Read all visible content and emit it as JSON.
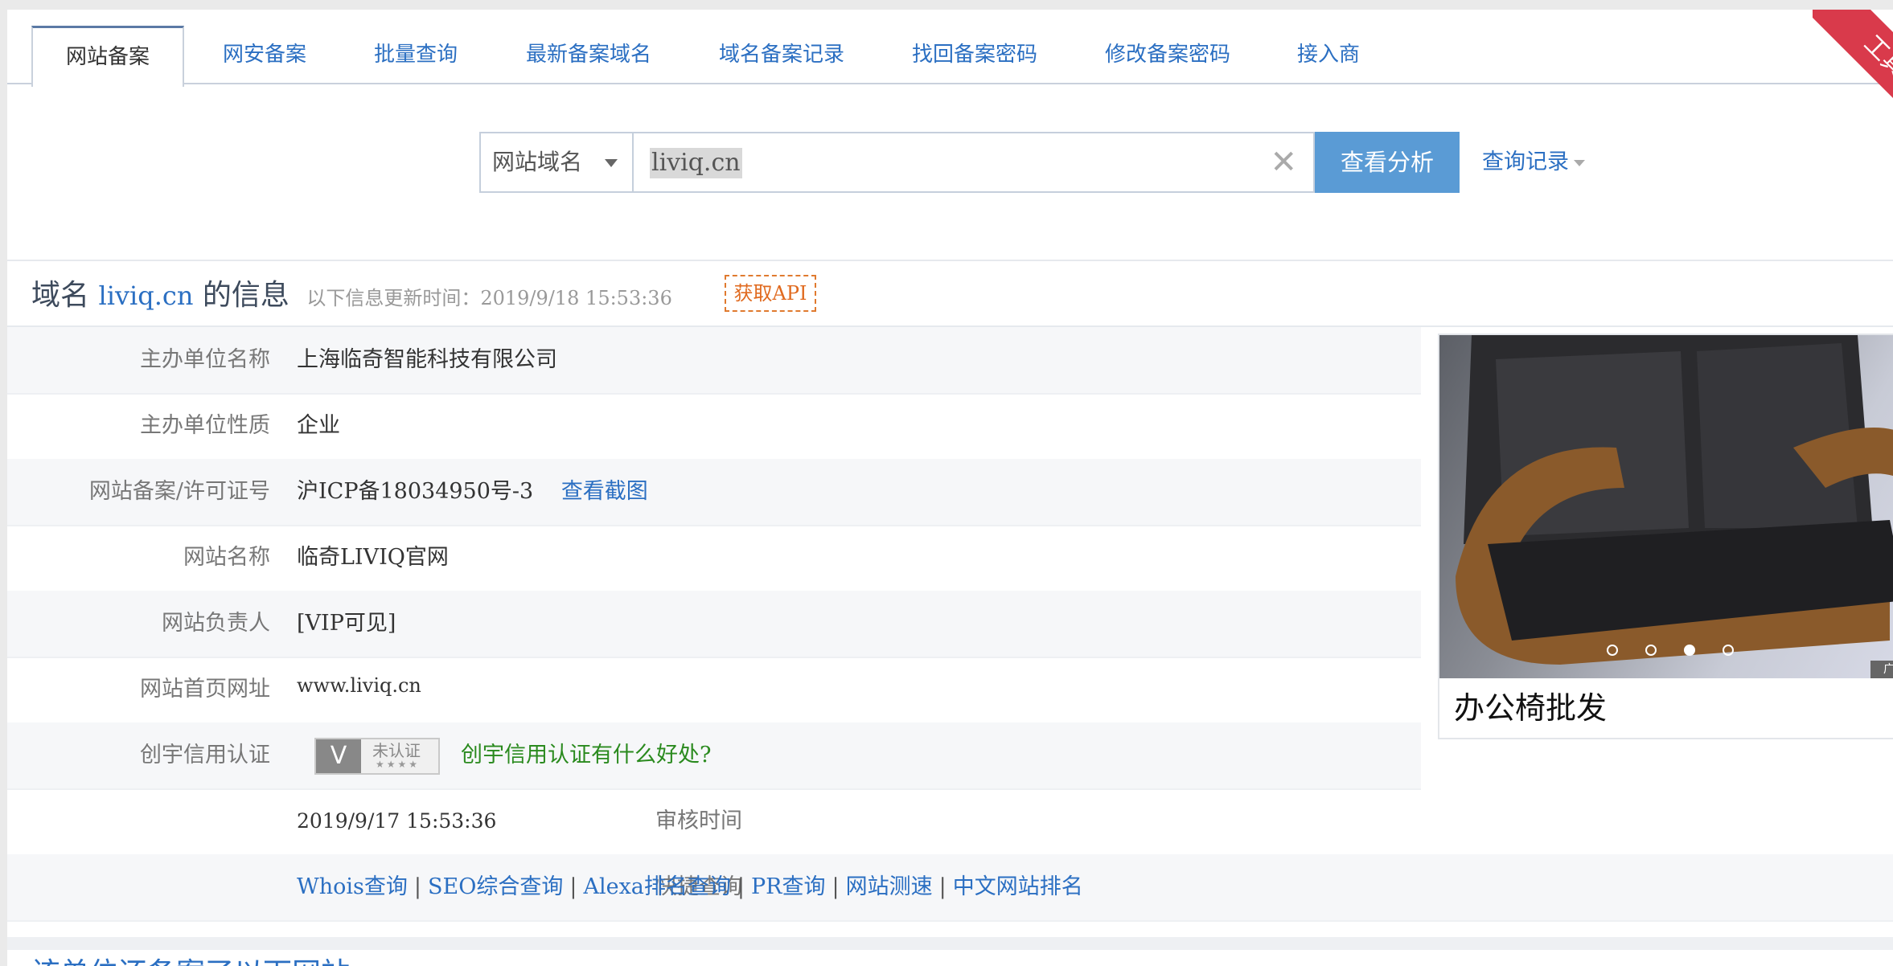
{
  "tabs": [
    "网站备案",
    "网安备案",
    "批量查询",
    "最新备案域名",
    "域名备案记录",
    "找回备案密码",
    "修改备案密码",
    "接入商"
  ],
  "corner_ribbon": "工具",
  "search": {
    "select_label": "网站域名",
    "input_value": "liviq.cn",
    "button_label": "查看分析",
    "history_label": "查询记录"
  },
  "heading": {
    "prefix": "域名",
    "domain": "liviq.cn",
    "suffix": "的信息",
    "updated": "以下信息更新时间：2019/9/18 15:53:36",
    "api_button": "获取API"
  },
  "info": {
    "sponsor_label": "主办单位名称",
    "sponsor_value": "上海临奇智能科技有限公司",
    "nature_label": "主办单位性质",
    "nature_value": "企业",
    "license_label": "网站备案/许可证号",
    "license_value": "沪ICP备18034950号-3",
    "screenshot_link": "查看截图",
    "site_name_label": "网站名称",
    "site_name_value": "临奇LIVIQ官网",
    "owner_label": "网站负责人",
    "owner_value": "[VIP可见]",
    "homepage_label": "网站首页网址",
    "homepage_value": "www.liviq.cn",
    "credit_label": "创宇信用认证",
    "credit_badge": "未认证",
    "credit_badge_stars": "★★★★",
    "credit_link": "创宇信用认证有什么好处?",
    "audit_label": "审核时间",
    "audit_value": "2019/9/17 15:53:36",
    "quick_label": "快捷查询",
    "quick_links": [
      "Whois查询",
      "SEO综合查询",
      "Alexa排名查询",
      "PR查询",
      "网站测速",
      "中文网站排名"
    ]
  },
  "ad": {
    "title": "办公椅批发",
    "mark": "广告",
    "active_slide": 3,
    "slide_count": 4
  },
  "bottom_heading": "该单位还备案了以下网站"
}
